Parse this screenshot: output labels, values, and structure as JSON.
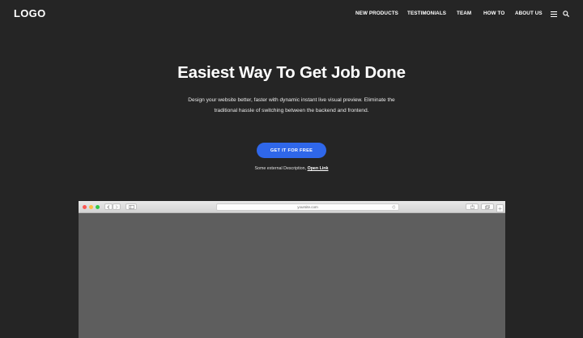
{
  "header": {
    "logo": "LOGO",
    "nav": [
      {
        "label": "NEW PRODUCTS"
      },
      {
        "label": "TESTIMONIALS"
      },
      {
        "label": "TEAM"
      },
      {
        "label": "HOW TO"
      },
      {
        "label": "ABOUT US"
      }
    ],
    "menu_icon": "hamburger-icon",
    "search_icon": "search-icon"
  },
  "hero": {
    "title": "Easiest Way To Get Job Done",
    "description": "Design your website better, faster with dynamic instant live visual preview. Eliminate the traditional hassle of switching between the backend and frontend.",
    "cta_label": "GET IT FOR FREE",
    "external_text": "Some external Description, ",
    "external_link": "Open Link"
  },
  "browser": {
    "url": "yoursite.com",
    "traffic_lights": [
      "#fc5753",
      "#fdbc40",
      "#33c748"
    ]
  },
  "colors": {
    "background": "#252525",
    "accent": "#2f67ea",
    "browser_viewport": "#5e5e5e"
  }
}
